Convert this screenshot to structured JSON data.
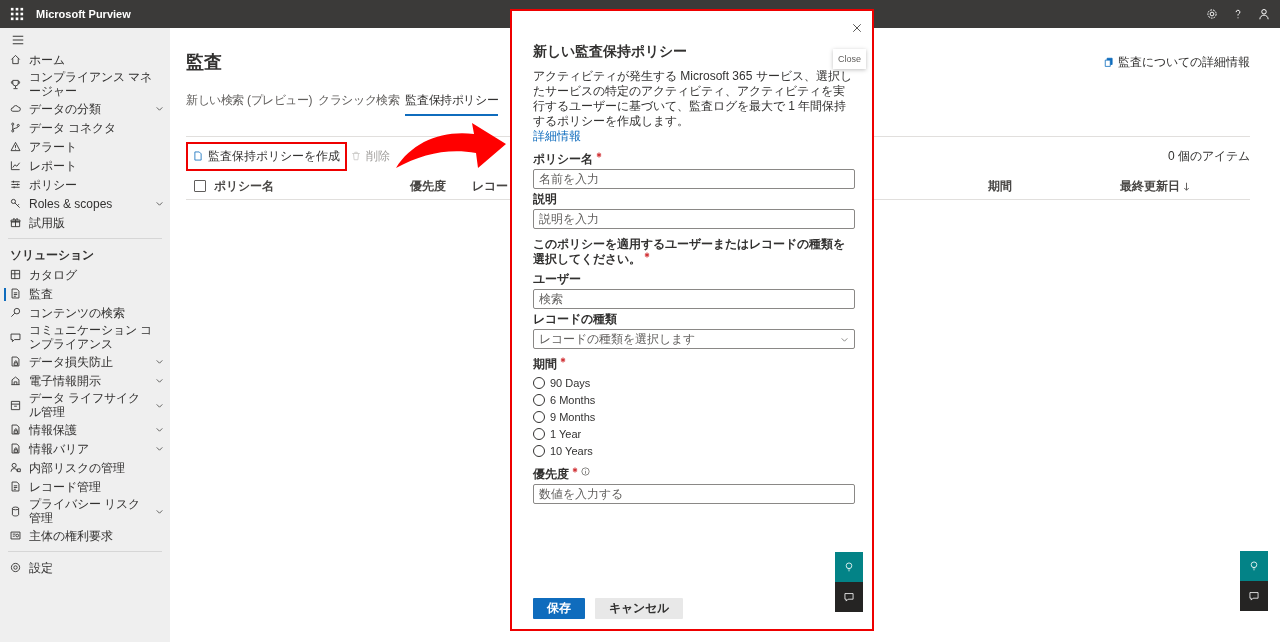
{
  "app_bar": {
    "title": "Microsoft Purview"
  },
  "sidebar": {
    "sections": [
      {
        "items": [
          {
            "label": "ホーム",
            "expandable": false,
            "selected": false
          },
          {
            "label": "コンプライアンス マネージャー",
            "expandable": false,
            "selected": false
          },
          {
            "label": "データの分類",
            "expandable": true,
            "selected": false
          },
          {
            "label": "データ コネクタ",
            "expandable": false,
            "selected": false
          },
          {
            "label": "アラート",
            "expandable": false,
            "selected": false
          },
          {
            "label": "レポート",
            "expandable": false,
            "selected": false
          },
          {
            "label": "ポリシー",
            "expandable": false,
            "selected": false
          },
          {
            "label": "Roles & scopes",
            "expandable": true,
            "selected": false
          },
          {
            "label": "試用版",
            "expandable": false,
            "selected": false
          }
        ]
      },
      {
        "heading": "ソリューション",
        "items": [
          {
            "label": "カタログ",
            "expandable": false,
            "selected": false
          },
          {
            "label": "監査",
            "expandable": false,
            "selected": true
          },
          {
            "label": "コンテンツの検索",
            "expandable": false,
            "selected": false
          },
          {
            "label": "コミュニケーション コンプライアンス",
            "expandable": false,
            "selected": false
          },
          {
            "label": "データ損失防止",
            "expandable": true,
            "selected": false
          },
          {
            "label": "電子情報開示",
            "expandable": true,
            "selected": false
          },
          {
            "label": "データ ライフサイクル管理",
            "expandable": true,
            "selected": false
          },
          {
            "label": "情報保護",
            "expandable": true,
            "selected": false
          },
          {
            "label": "情報バリア",
            "expandable": true,
            "selected": false
          },
          {
            "label": "内部リスクの管理",
            "expandable": false,
            "selected": false
          },
          {
            "label": "レコード管理",
            "expandable": false,
            "selected": false
          },
          {
            "label": "プライバシー リスク管理",
            "expandable": true,
            "selected": false
          },
          {
            "label": "主体の権利要求",
            "expandable": false,
            "selected": false
          }
        ]
      },
      {
        "items": [
          {
            "label": "設定",
            "expandable": false,
            "selected": false
          }
        ]
      }
    ]
  },
  "main": {
    "title": "監査",
    "learn_more": "監査についての詳細情報",
    "tabs": [
      {
        "label": "新しい検索 (プレビュー)",
        "selected": false
      },
      {
        "label": "クラシック検索",
        "selected": false
      },
      {
        "label": "監査保持ポリシー",
        "selected": true
      }
    ],
    "toolbar": {
      "create_button": "監査保持ポリシーを作成",
      "delete_button": {
        "label": "削除",
        "disabled": true
      },
      "item_count": "0 個のアイテム"
    },
    "table": {
      "select_all": {
        "checked": false
      },
      "columns": [
        {
          "label": "ポリシー名",
          "sorted_descending": false
        },
        {
          "label": "優先度",
          "sorted_descending": false
        },
        {
          "label": "レコー",
          "sorted_descending": false
        },
        {
          "label": "期間",
          "sorted_descending": false
        },
        {
          "label": "最終更新日",
          "sorted_descending": true
        }
      ]
    }
  },
  "panel": {
    "title": "新しい監査保持ポリシー",
    "close_tooltip": "Close",
    "description": "アクティビティが発生する Microsoft 365 サービス、選択したサービスの特定のアクティビティ、アクティビティを実行するユーザーに基づいて、監査ログを最大で 1 年間保持するポリシーを作成します。",
    "description_link": "詳細情報",
    "policy_name": {
      "label": "ポリシー名",
      "required": true,
      "placeholder": "名前を入力"
    },
    "policy_description": {
      "label": "説明",
      "required": false,
      "placeholder": "説明を入力"
    },
    "scope_prompt": {
      "label": "このポリシーを適用するユーザーまたはレコードの種類を選択してください。",
      "required": true
    },
    "users": {
      "label": "ユーザー",
      "required": false,
      "placeholder": "検索"
    },
    "record_types": {
      "label": "レコードの種類",
      "required": false,
      "placeholder": "レコードの種類を選択します"
    },
    "duration": {
      "label": "期間",
      "required": true,
      "options": [
        {
          "label": "90 Days",
          "selected": false
        },
        {
          "label": "6 Months",
          "selected": false
        },
        {
          "label": "9 Months",
          "selected": false
        },
        {
          "label": "1 Year",
          "selected": false
        },
        {
          "label": "10 Years",
          "selected": false
        }
      ]
    },
    "priority": {
      "label": "優先度",
      "required": true,
      "placeholder": "数値を入力する"
    },
    "buttons": [
      {
        "label": "保存",
        "kind": "primary"
      },
      {
        "label": "キャンセル",
        "kind": "secondary"
      }
    ]
  }
}
